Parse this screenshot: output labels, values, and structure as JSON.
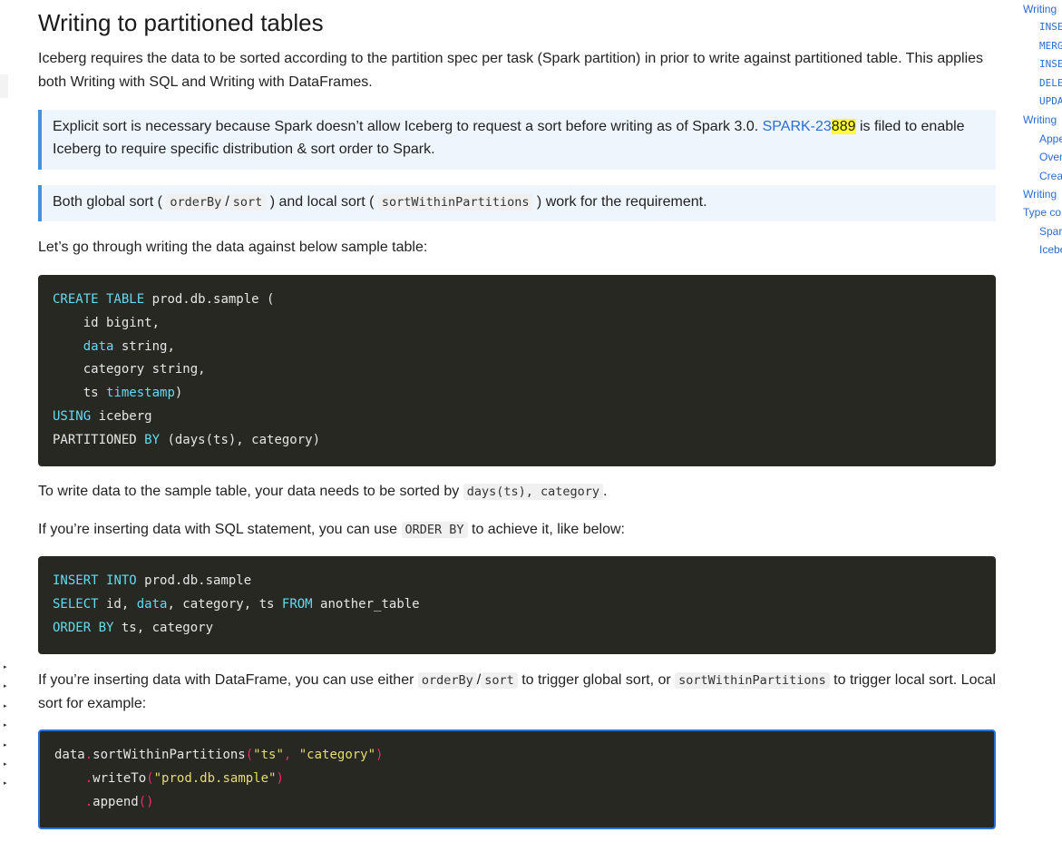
{
  "section": {
    "title": "Writing to partitioned tables"
  },
  "intro": "Iceberg requires the data to be sorted according to the partition spec per task (Spark partition) in prior to write against partitioned table. This applies both Writing with SQL and Writing with DataFrames.",
  "callout1": {
    "pre": "Explicit sort is necessary because Spark doesn’t allow Iceberg to request a sort before writing as of Spark 3.0. ",
    "link": "SPARK-23",
    "highlight": "889",
    "post": " is filed to enable Iceberg to require specific distribution & sort order to Spark."
  },
  "callout2": {
    "t1": "Both global sort (",
    "c1": "orderBy",
    "sep": "/",
    "c2": "sort",
    "t2": ") and local sort (",
    "c3": "sortWithinPartitions",
    "t3": ") work for the requirement."
  },
  "p_sample": "Let’s go through writing the data against below sample table:",
  "code1": {
    "l1_kw": "CREATE TABLE",
    "l1_rest": " prod.db.sample (",
    "l2": "    id bigint,",
    "l3_pre": "    ",
    "l3_kw": "data",
    "l3_rest": " string,",
    "l4": "    category string,",
    "l5_pre": "    ts ",
    "l5_kw": "timestamp",
    "l5_rest": ")",
    "l6_kw": "USING",
    "l6_rest": " iceberg",
    "l7_pre": "PARTITIONED ",
    "l7_kw": "BY",
    "l7_rest": " (days(ts), category)"
  },
  "p_sorted": {
    "pre": "To write data to the sample table, your data needs to be sorted by ",
    "code": "days(ts), category",
    "post": "."
  },
  "p_sql": {
    "pre": "If you’re inserting data with SQL statement, you can use ",
    "code": "ORDER BY",
    "post": " to achieve it, like below:"
  },
  "code2": {
    "l1_kw1": "INSERT",
    "l1_kw2": "INTO",
    "l1_rest": " prod.db.sample",
    "l2_kw": "SELECT",
    "l2_mid": " id, ",
    "l2_kw2": "data",
    "l2_mid2": ", category, ts ",
    "l2_kw3": "FROM",
    "l2_rest": " another_table",
    "l3_kw": "ORDER BY",
    "l3_rest": " ts, category"
  },
  "p_df": {
    "pre": "If you’re inserting data with DataFrame, you can use either ",
    "c1": "orderBy",
    "sep": "/",
    "c2": "sort",
    "mid": " to trigger global sort, or ",
    "c3": "sortWithinPartitions",
    "post": " to trigger local sort. Local sort for example:"
  },
  "code3": {
    "l1_a": "data",
    "l1_dot": ".",
    "l1_fn": "sortWithinPartitions",
    "l1_p1": "(",
    "l1_s1": "\"ts\"",
    "l1_comma": ", ",
    "l1_s2": "\"category\"",
    "l1_p2": ")",
    "l2_indent": "    ",
    "l2_dot": ".",
    "l2_fn": "writeTo",
    "l2_p1": "(",
    "l2_s": "\"prod.db.sample\"",
    "l2_p2": ")",
    "l3_indent": "    ",
    "l3_dot": ".",
    "l3_fn": "append",
    "l3_p": "()"
  },
  "toc": [
    {
      "label": "Writing",
      "sub": false,
      "mono": false
    },
    {
      "label": "INSE",
      "sub": true,
      "mono": true
    },
    {
      "label": "MERG",
      "sub": true,
      "mono": true
    },
    {
      "label": "INSE",
      "sub": true,
      "mono": true
    },
    {
      "label": "DELE",
      "sub": true,
      "mono": true
    },
    {
      "label": "UPDA",
      "sub": true,
      "mono": true
    },
    {
      "label": "Writing",
      "sub": false,
      "mono": false
    },
    {
      "label": "Appe",
      "sub": true,
      "mono": false
    },
    {
      "label": "Over",
      "sub": true,
      "mono": false
    },
    {
      "label": "Crea",
      "sub": true,
      "mono": false
    },
    {
      "label": "Writing",
      "sub": false,
      "mono": false
    },
    {
      "label": "Type co",
      "sub": false,
      "mono": false
    },
    {
      "label": "Spar",
      "sub": true,
      "mono": false
    },
    {
      "label": "Icebe",
      "sub": true,
      "mono": false
    }
  ],
  "left_arrows": [
    "▸",
    "▸",
    "▸",
    "▸",
    "▸",
    "▸",
    "▸"
  ]
}
